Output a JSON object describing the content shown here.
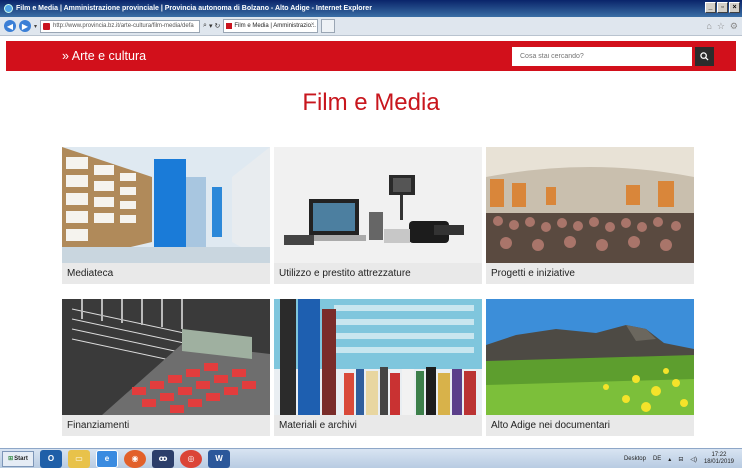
{
  "window": {
    "title": "Film e Media | Amministrazione provinciale | Provincia autonoma di Bolzano - Alto Adige - Internet Explorer"
  },
  "browser": {
    "address": "http://www.provincia.bz.it/arte-cultura/film-media/defa",
    "tab_label": "Film e Media | Amministrazio...",
    "tab_close": "×"
  },
  "header": {
    "section_link": "» Arte e cultura",
    "search_placeholder": "Cosa stai cercando?"
  },
  "page": {
    "title": "Film e Media"
  },
  "tiles": [
    {
      "label": "Mediateca"
    },
    {
      "label": "Utilizzo e prestito attrezzature"
    },
    {
      "label": "Progetti e iniziative"
    },
    {
      "label": "Finanziamenti"
    },
    {
      "label": "Materiali e archivi"
    },
    {
      "label": "Alto Adige nei documentari"
    }
  ],
  "taskbar": {
    "start": "Start",
    "desktop": "Desktop",
    "lang": "DE",
    "time": "17:22",
    "date": "18/01/2019"
  },
  "colors": {
    "brand_red": "#d2101b",
    "title_red": "#c8161d"
  }
}
